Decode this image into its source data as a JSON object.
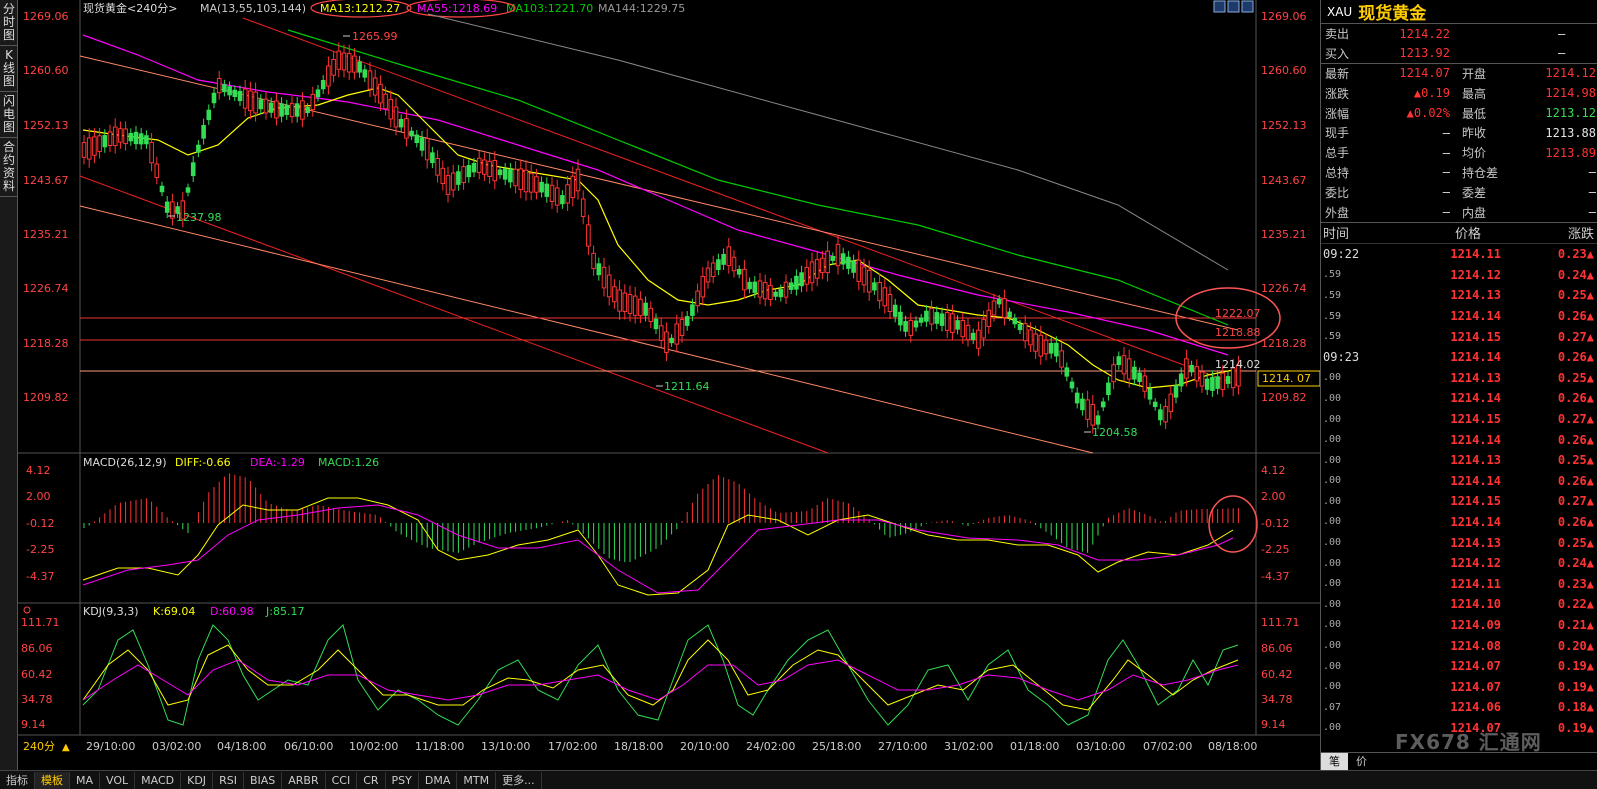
{
  "left_tabs": [
    "分时图",
    "K线图",
    "闪电图",
    "合约资料"
  ],
  "main_header": {
    "title": "现货黄金<240分>",
    "ma_label": "MA(13,55,103,144)",
    "ma13": "MA13:1212.27",
    "ma55": "MA55:1218.69",
    "ma103": "MA103:1221.70",
    "ma144": "MA144:1229.75"
  },
  "price_axis": [
    "1269.06",
    "1260.60",
    "1252.13",
    "1243.67",
    "1235.21",
    "1226.74",
    "1218.28",
    "1209.82"
  ],
  "price_annotations": {
    "high": "1265.99",
    "low1": "1237.98",
    "low2": "1211.64",
    "low3": "1204.58",
    "level1": "1222.07",
    "level2": "1218.88",
    "last": "1214.02",
    "current_tag": "1214. 07"
  },
  "macd": {
    "label": "MACD(26,12,9)",
    "diff": "DIFF:-0.66",
    "dea": "DEA:-1.29",
    "macd": "MACD:1.26",
    "axis": [
      "4.12",
      "2.00",
      "-0.12",
      "-2.25",
      "-4.37"
    ]
  },
  "kdj": {
    "label": "KDJ(9,3,3)",
    "k": "K:69.04",
    "d": "D:60.98",
    "j": "J:85.17",
    "axis": [
      "111.71",
      "86.06",
      "60.42",
      "34.78",
      "9.14"
    ]
  },
  "time_axis": [
    "29/10:00",
    "03/02:00",
    "04/18:00",
    "06/10:00",
    "10/02:00",
    "11/18:00",
    "13/10:00",
    "17/02:00",
    "18/18:00",
    "20/10:00",
    "24/02:00",
    "25/18:00",
    "27/10:00",
    "31/02:00",
    "01/18:00",
    "03/10:00",
    "07/02:00",
    "08/18:00"
  ],
  "period_label": "240分",
  "bottom_tabs": [
    "指标",
    "模板",
    "MA",
    "VOL",
    "MACD",
    "KDJ",
    "RSI",
    "BIAS",
    "ARBR",
    "CCI",
    "CR",
    "PSY",
    "DMA",
    "MTM",
    "更多..."
  ],
  "quote": {
    "code": "XAU",
    "name": "现货黄金",
    "sell": "1214.22",
    "buy": "1213.92",
    "sell_label": "卖出",
    "buy_label": "买入",
    "dash": "—",
    "rows": [
      {
        "k": "最新",
        "v": "1214.07",
        "k2": "开盘",
        "v2": "1214.12"
      },
      {
        "k": "涨跌",
        "v": "▲0.19",
        "k2": "最高",
        "v2": "1214.98"
      },
      {
        "k": "涨幅",
        "v": "▲0.02%",
        "k2": "最低",
        "v2": "1213.12"
      },
      {
        "k": "现手",
        "v": "—",
        "k2": "昨收",
        "v2": "1213.88"
      },
      {
        "k": "总手",
        "v": "—",
        "k2": "均价",
        "v2": "1213.89"
      },
      {
        "k": "总持",
        "v": "—",
        "k2": "持仓差",
        "v2": "—"
      },
      {
        "k": "委比",
        "v": "—",
        "k2": "委差",
        "v2": "—"
      },
      {
        "k": "外盘",
        "v": "—",
        "k2": "内盘",
        "v2": "—"
      }
    ]
  },
  "ticks_header": {
    "time": "时间",
    "price": "价格",
    "change": "涨跌"
  },
  "ticks": [
    {
      "t": "09:22",
      "p": "1214.11",
      "c": "0.23▲"
    },
    {
      "t": ".59",
      "p": "1214.12",
      "c": "0.24▲"
    },
    {
      "t": ".59",
      "p": "1214.13",
      "c": "0.25▲"
    },
    {
      "t": ".59",
      "p": "1214.14",
      "c": "0.26▲"
    },
    {
      "t": ".59",
      "p": "1214.15",
      "c": "0.27▲"
    },
    {
      "t": "09:23",
      "p": "1214.14",
      "c": "0.26▲"
    },
    {
      "t": ".00",
      "p": "1214.13",
      "c": "0.25▲"
    },
    {
      "t": ".00",
      "p": "1214.14",
      "c": "0.26▲"
    },
    {
      "t": ".00",
      "p": "1214.15",
      "c": "0.27▲"
    },
    {
      "t": ".00",
      "p": "1214.14",
      "c": "0.26▲"
    },
    {
      "t": ".00",
      "p": "1214.13",
      "c": "0.25▲"
    },
    {
      "t": ".00",
      "p": "1214.14",
      "c": "0.26▲"
    },
    {
      "t": ".00",
      "p": "1214.15",
      "c": "0.27▲"
    },
    {
      "t": ".00",
      "p": "1214.14",
      "c": "0.26▲"
    },
    {
      "t": ".00",
      "p": "1214.13",
      "c": "0.25▲"
    },
    {
      "t": ".00",
      "p": "1214.12",
      "c": "0.24▲"
    },
    {
      "t": ".00",
      "p": "1214.11",
      "c": "0.23▲"
    },
    {
      "t": ".00",
      "p": "1214.10",
      "c": "0.22▲"
    },
    {
      "t": ".00",
      "p": "1214.09",
      "c": "0.21▲"
    },
    {
      "t": ".00",
      "p": "1214.08",
      "c": "0.20▲"
    },
    {
      "t": ".00",
      "p": "1214.07",
      "c": "0.19▲"
    },
    {
      "t": ".00",
      "p": "1214.07",
      "c": "0.19▲"
    },
    {
      "t": ".07",
      "p": "1214.06",
      "c": "0.18▲"
    },
    {
      "t": ".00",
      "p": "1214.07",
      "c": "0.19▲"
    }
  ],
  "right_bottom_tabs": [
    "笔",
    "价"
  ],
  "watermark": "FX678 汇通网",
  "colors": {
    "up": "#ff3333",
    "down": "#33dd55",
    "ma13": "#ffff00",
    "ma55": "#ff00ff",
    "ma103": "#00cc00",
    "ma144": "#888888"
  }
}
